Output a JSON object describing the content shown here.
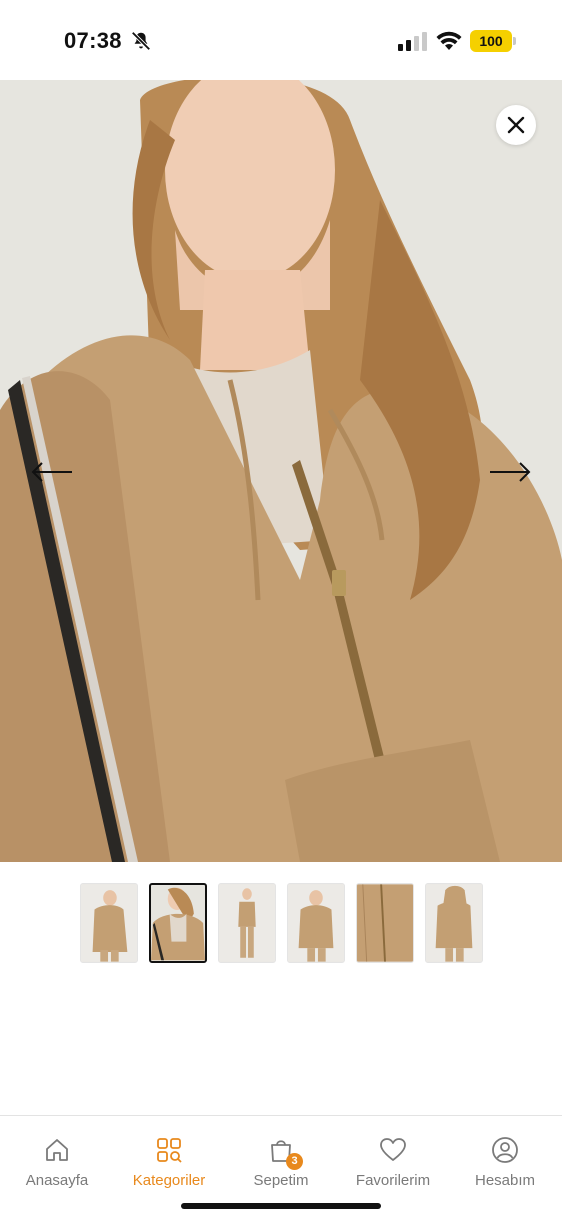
{
  "status_bar": {
    "time": "07:38",
    "battery": "100",
    "battery_color": "#f5d000"
  },
  "product_gallery": {
    "main_image_alt": "",
    "total_images": 6,
    "active_index": 1
  },
  "bottom_nav": {
    "items": [
      {
        "label": "Anasayfa",
        "icon": "home-icon"
      },
      {
        "label": "Kategoriler",
        "icon": "categories-icon",
        "active": true
      },
      {
        "label": "Sepetim",
        "icon": "cart-icon",
        "badge": "3"
      },
      {
        "label": "Favorilerim",
        "icon": "heart-icon"
      },
      {
        "label": "Hesabım",
        "icon": "account-icon"
      }
    ],
    "accent_color": "#e8891d"
  }
}
